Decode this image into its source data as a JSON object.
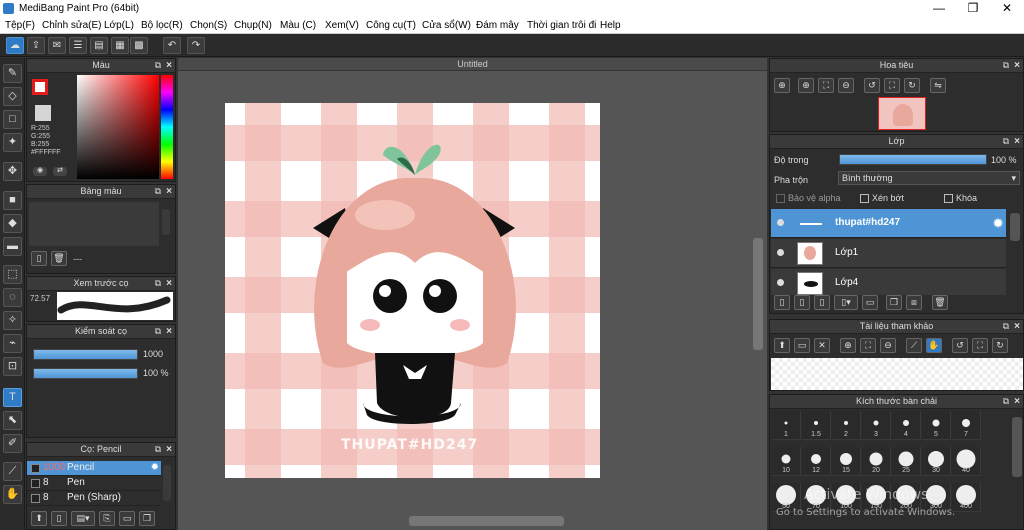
{
  "window": {
    "title": "MediBang Paint Pro (64bit)",
    "minimize": "—",
    "maximize": "❐",
    "close": "✕"
  },
  "menu": [
    "Tệp(F)",
    "Chỉnh sửa(E)",
    "Lớp(L)",
    "Bộ lọc(R)",
    "Chọn(S)",
    "Chụp(N)",
    "Màu (C)",
    "Xem(V)",
    "Công cụ(T)",
    "Cửa sổ(W)",
    "Đám mây",
    "Thời gian trôi đi",
    "Help"
  ],
  "color_panel": {
    "title": "Màu",
    "r": "R:255",
    "g": "G:255",
    "b": "B:255",
    "hex": "#FFFFFF"
  },
  "palette_panel": {
    "title": "Bảng màu",
    "dash": "---"
  },
  "brush_preview_panel": {
    "title": "Xem trước cọ",
    "size": "72.57"
  },
  "brush_control_panel": {
    "title": "Kiểm soát cọ",
    "size_value": "1000",
    "opacity_value": "100 %",
    "size_fill": 1.0,
    "opacity_fill": 1.0
  },
  "brush_panel": {
    "title": "Cọ: Pencil",
    "items": [
      {
        "size": "1000",
        "name": "Pencil",
        "selected": true
      },
      {
        "size": "8",
        "name": "Pen",
        "selected": false
      },
      {
        "size": "8",
        "name": "Pen (Sharp)",
        "selected": false
      }
    ]
  },
  "canvas": {
    "tab": "Untitled",
    "watermark": "THUPAT#HD247"
  },
  "navigator_panel": {
    "title": "Hoa tiêu"
  },
  "layer_panel": {
    "title": "Lớp",
    "opacity_label": "Độ trong",
    "opacity_value": "100 %",
    "opacity_fill": 1.0,
    "blend_label": "Pha trộn",
    "blend_value": "Bình thường",
    "protect_alpha": "Bảo vệ alpha",
    "clipping": "Xén bớt",
    "lock": "Khóa",
    "layers": [
      {
        "name": "thupat#hd247",
        "selected": true
      },
      {
        "name": "Lớp1",
        "selected": false
      },
      {
        "name": "Lớp4",
        "selected": false
      }
    ]
  },
  "reference_panel": {
    "title": "Tài liệu tham khảo"
  },
  "brush_size_panel": {
    "title": "Kích thước bàn chải",
    "sizes": [
      "1",
      "1.5",
      "2",
      "3",
      "4",
      "5",
      "7",
      "10",
      "12",
      "15",
      "20",
      "25",
      "30",
      "40",
      "50",
      "70",
      "100",
      "150",
      "200",
      "300",
      "400"
    ]
  },
  "activation": {
    "line1": "Activate Windows",
    "line2": "Go to Settings to activate Windows."
  },
  "colors": {
    "accent": "#2f7bc5",
    "selected_row": "#4f95d6",
    "canvas_pink": "#f1b9b3"
  }
}
